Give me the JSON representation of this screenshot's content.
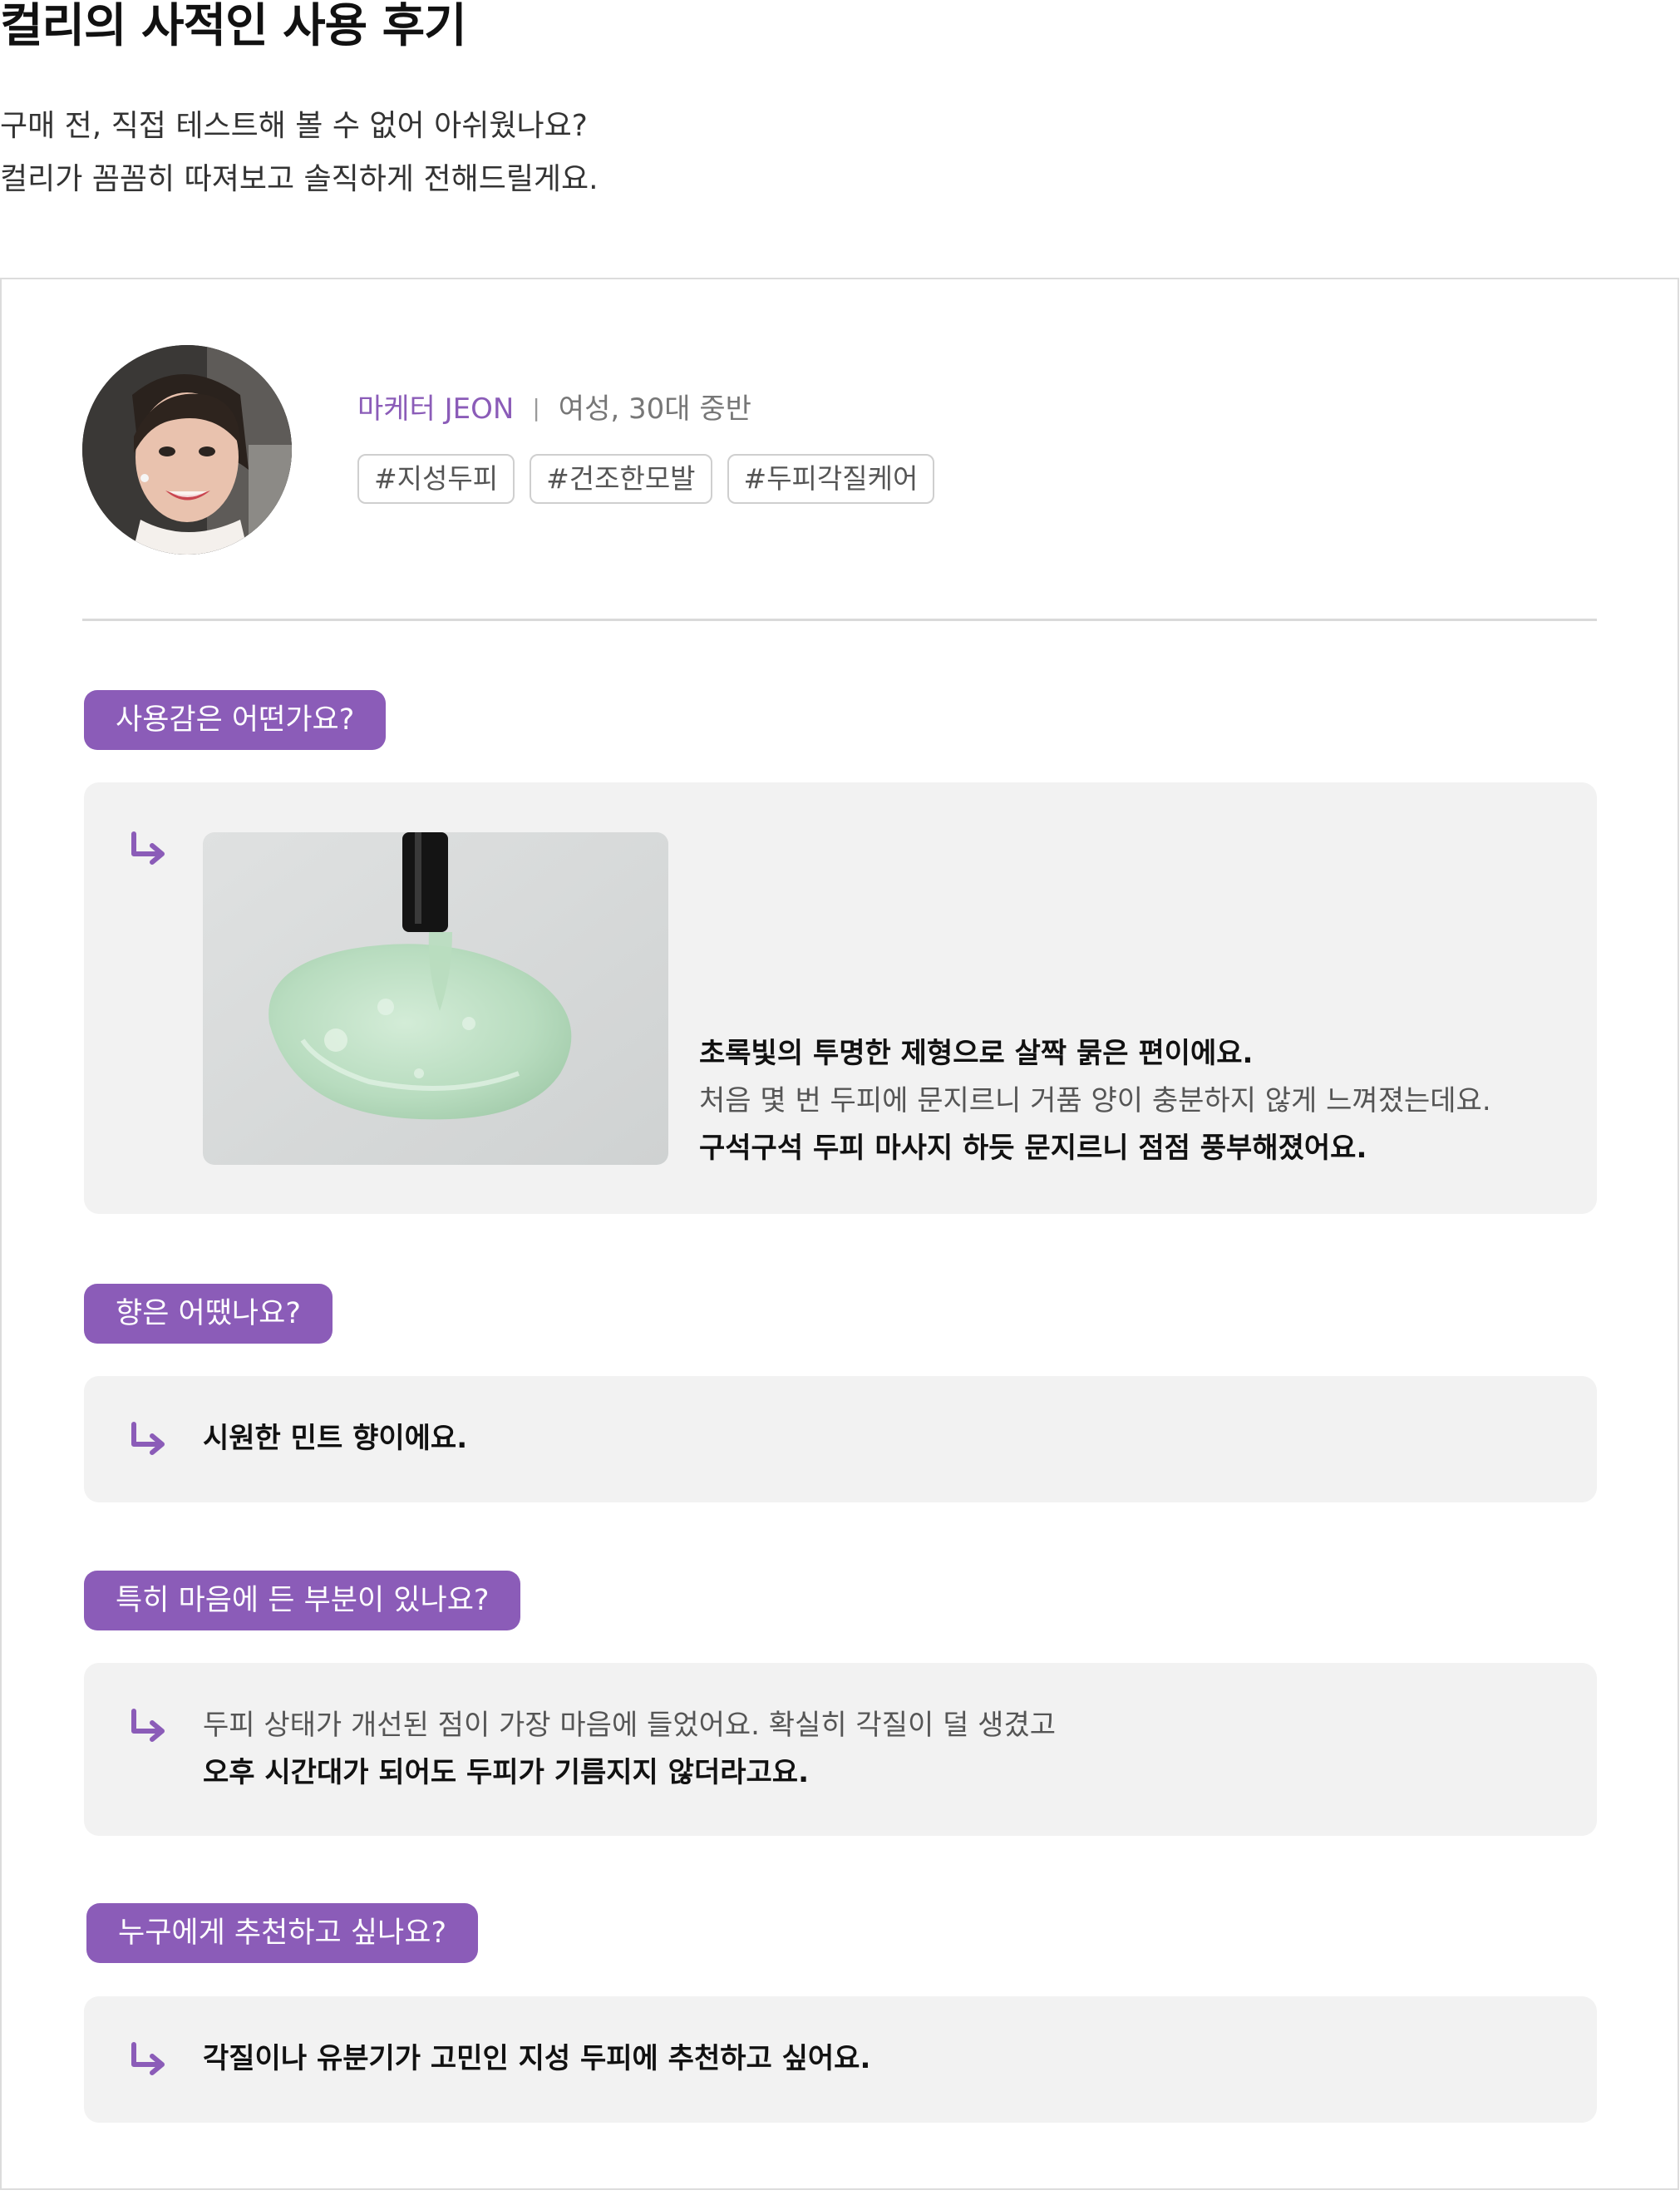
{
  "page": {
    "title": "컬리의 사적인 사용 후기",
    "intro": [
      "구매 전, 직접 테스트해 볼 수 없어 아쉬웠나요?",
      "컬리가 꼼꼼히 따져보고 솔직하게 전해드릴게요."
    ]
  },
  "reviewer": {
    "name": "마케터 JEON",
    "separator": "|",
    "info": "여성, 30대 중반",
    "tags": [
      "#지성두피",
      "#건조한모발",
      "#두피각질케어"
    ]
  },
  "qa": [
    {
      "question": "사용감은 어떤가요?",
      "answer_lines": [
        "초록빛의 투명한 제형으로 살짝 묽은 편이에요.",
        "처음 몇 번 두피에 문지르니 거품 양이 충분하지 않게 느껴졌는데요.",
        "구석구석 두피 마사지 하듯 문지르니 점점 풍부해졌어요."
      ]
    },
    {
      "question": "향은 어땠나요?",
      "answer_lines": [
        "시원한 민트 향이에요."
      ]
    },
    {
      "question": "특히 마음에 든 부분이 있나요?",
      "answer_lines": [
        "두피 상태가 개선된 점이 가장 마음에 들었어요. 확실히 각질이 덜 생겼고",
        "오후 시간대가 되어도 두피가 기름지지 않더라고요."
      ]
    },
    {
      "question": "누구에게 추천하고 싶나요?",
      "answer_lines": [
        "각질이나 유분기가 고민인 지성 두피에 추천하고 싶어요."
      ]
    }
  ],
  "icons": {
    "answer_arrow": "arrow-down-right-icon",
    "reviewer_photo": "reviewer-avatar",
    "product_photo": "green-gel-texture-photo"
  },
  "colors": {
    "accent": "#8b5cb8",
    "answer_bg": "#f2f2f2",
    "border": "#dcdcdc"
  }
}
